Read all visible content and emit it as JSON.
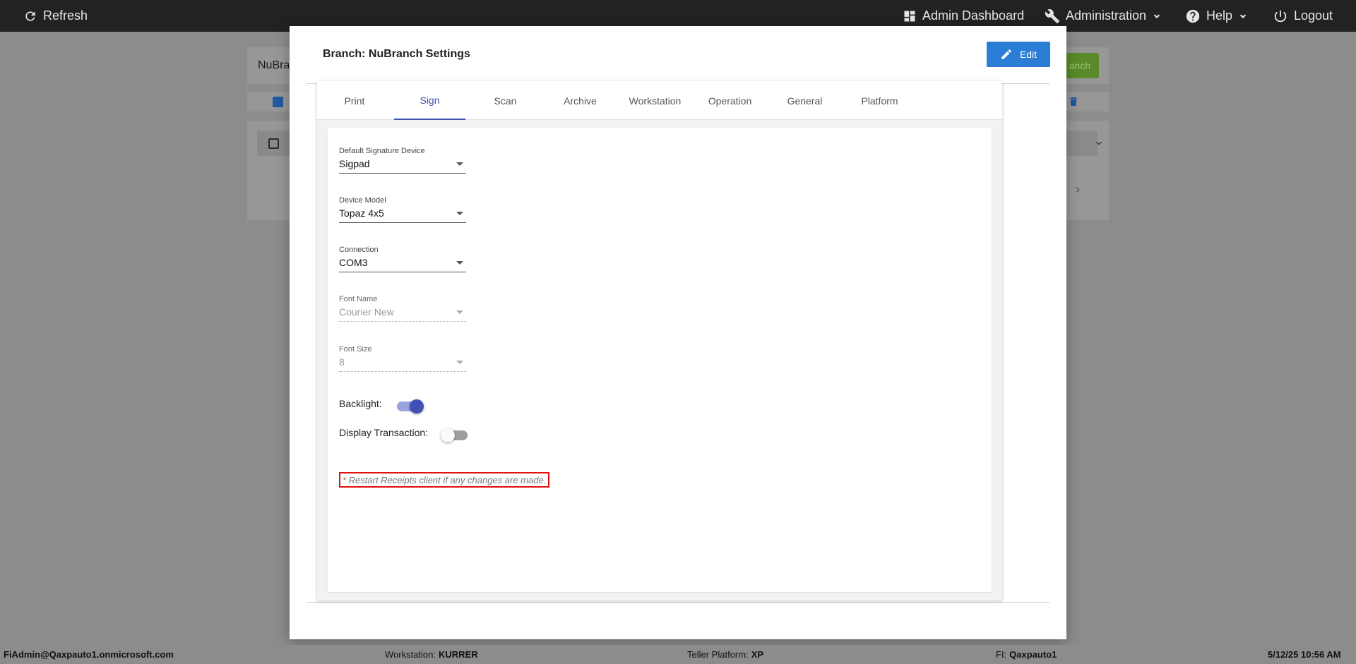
{
  "topbar": {
    "refresh_label": "Refresh",
    "admin_dashboard_label": "Admin Dashboard",
    "administration_label": "Administration",
    "help_label": "Help",
    "logout_label": "Logout"
  },
  "background": {
    "branch_input_value": "NuBra",
    "green_button_label": "anch"
  },
  "modal": {
    "title": "Branch: NuBranch Settings",
    "edit_label": "Edit",
    "tabs": [
      {
        "label": "Print"
      },
      {
        "label": "Sign"
      },
      {
        "label": "Scan"
      },
      {
        "label": "Archive"
      },
      {
        "label": "Workstation"
      },
      {
        "label": "Operation"
      },
      {
        "label": "General"
      },
      {
        "label": "Platform"
      }
    ],
    "active_tab": "Sign",
    "fields": {
      "default_signature_device": {
        "label": "Default Signature Device",
        "value": "Sigpad"
      },
      "device_model": {
        "label": "Device Model",
        "value": "Topaz 4x5"
      },
      "connection": {
        "label": "Connection",
        "value": "COM3"
      },
      "font_name": {
        "label": "Font Name",
        "value": "Courier New"
      },
      "font_size": {
        "label": "Font Size",
        "value": "8"
      }
    },
    "toggles": {
      "backlight": {
        "label": "Backlight:",
        "on": true
      },
      "display_transaction": {
        "label": "Display Transaction:",
        "on": false
      }
    },
    "notice": "* Restart Receipts client if any changes are made."
  },
  "footer": {
    "user": "FiAdmin@Qaxpauto1.onmicrosoft.com",
    "workstation_label": "Workstation:",
    "workstation_value": "KURRER",
    "platform_label": "Teller Platform:",
    "platform_value": "XP",
    "fi_label": "FI:",
    "fi_value": "Qaxpauto1",
    "datetime": "5/12/25 10:56 AM"
  },
  "colors": {
    "accent": "#3f51b5",
    "edit_button": "#2b7dd6",
    "topbar": "#222222",
    "notice_border": "#e01010"
  }
}
